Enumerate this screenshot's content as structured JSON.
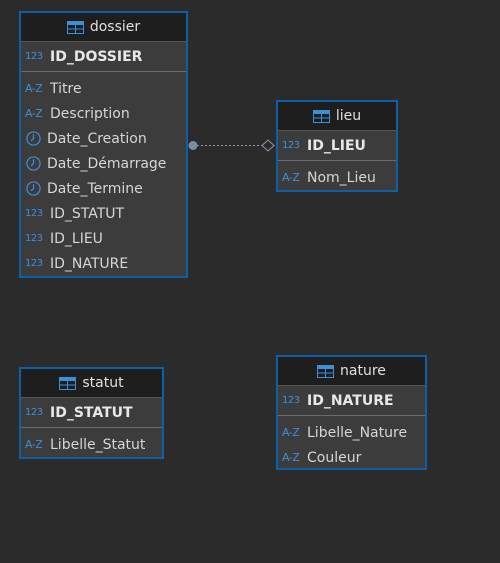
{
  "colors": {
    "background": "#2b2b2b",
    "border": "#0d5fa6",
    "header": "#1e1e1e",
    "body": "#3c3c3c",
    "type_icon": "#3d8fd6"
  },
  "entities": {
    "dossier": {
      "title": "dossier",
      "pk": {
        "type": "123",
        "name": "ID_DOSSIER"
      },
      "columns": [
        {
          "type": "A-Z",
          "icon": "text-type-icon",
          "name": "Titre"
        },
        {
          "type": "A-Z",
          "icon": "text-type-icon",
          "name": "Description"
        },
        {
          "type": "",
          "icon": "clock-icon",
          "name": "Date_Creation"
        },
        {
          "type": "",
          "icon": "clock-icon",
          "name": "Date_Démarrage"
        },
        {
          "type": "",
          "icon": "clock-icon",
          "name": "Date_Termine"
        },
        {
          "type": "123",
          "icon": "number-type-icon",
          "name": "ID_STATUT"
        },
        {
          "type": "123",
          "icon": "number-type-icon",
          "name": "ID_LIEU"
        },
        {
          "type": "123",
          "icon": "number-type-icon",
          "name": "ID_NATURE"
        }
      ]
    },
    "lieu": {
      "title": "lieu",
      "pk": {
        "type": "123",
        "name": "ID_LIEU"
      },
      "columns": [
        {
          "type": "A-Z",
          "icon": "text-type-icon",
          "name": "Nom_Lieu"
        }
      ]
    },
    "statut": {
      "title": "statut",
      "pk": {
        "type": "123",
        "name": "ID_STATUT"
      },
      "columns": [
        {
          "type": "A-Z",
          "icon": "text-type-icon",
          "name": "Libelle_Statut"
        }
      ]
    },
    "nature": {
      "title": "nature",
      "pk": {
        "type": "123",
        "name": "ID_NATURE"
      },
      "columns": [
        {
          "type": "A-Z",
          "icon": "text-type-icon",
          "name": "Libelle_Nature"
        },
        {
          "type": "A-Z",
          "icon": "text-type-icon",
          "name": "Couleur"
        }
      ]
    }
  },
  "relationships": [
    {
      "from": "dossier",
      "to": "lieu"
    }
  ]
}
